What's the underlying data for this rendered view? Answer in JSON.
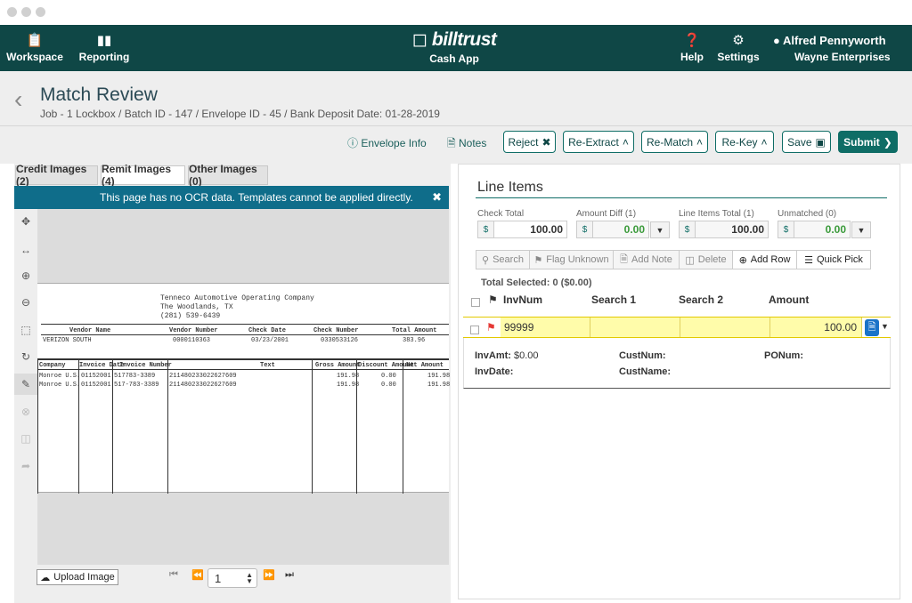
{
  "nav": {
    "workspace": "Workspace",
    "reporting": "Reporting",
    "brand": "billtrust",
    "brand_sub": "Cash App",
    "help": "Help",
    "settings": "Settings",
    "user_name": "Alfred Pennyworth",
    "user_org": "Wayne Enterprises"
  },
  "header": {
    "title": "Match Review",
    "breadcrumb": "Job - 1 Lockbox / Batch ID - 147 / Envelope ID - 45 / Bank Deposit Date: 01-28-2019"
  },
  "toolbar": {
    "envelope_info": "Envelope Info",
    "notes": "Notes",
    "reject": "Reject",
    "re_extract": "Re-Extract",
    "re_match": "Re-Match",
    "re_key": "Re-Key",
    "save": "Save",
    "submit": "Submit"
  },
  "images": {
    "tabs": [
      "Credit Images (2)",
      "Remit Images (4)",
      "Other Images (0)"
    ],
    "active_tab": 1,
    "banner": "This page has no OCR data. Templates cannot be applied directly.",
    "upload": "Upload Image",
    "page": "1"
  },
  "document": {
    "company": "Tenneco Automotive Operating Company",
    "city": "The Woodlands, TX",
    "phone": "(281) 539-6439",
    "h_vendor_name": "Vendor Name",
    "h_vendor_number": "Vendor Number",
    "h_check_date": "Check Date",
    "h_check_number": "Check Number",
    "h_total_amount": "Total Amount",
    "vendor_name": "VERIZON SOUTH",
    "vendor_number": "0000110363",
    "check_date": "03/23/2001",
    "check_number": "0330533126",
    "total_amount": "383.96",
    "cols": [
      "Company",
      "Invoice Date",
      "Invoice Number",
      "Text",
      "Gross Amount",
      "Discount Amount",
      "Net Amount"
    ],
    "rows": [
      [
        "Monroe U.S.",
        "01152001",
        "517783-3389",
        "211480233022627609",
        "191.98",
        "0.00",
        "191.98"
      ],
      [
        "Monroe U.S.",
        "01152001",
        "517-783-3389",
        "211480233022627609",
        "191.98",
        "0.00",
        "191.98"
      ]
    ]
  },
  "line_items": {
    "title": "Line Items",
    "check_total_label": "Check Total",
    "check_total": "100.00",
    "amount_diff_label": "Amount Diff (1)",
    "amount_diff": "0.00",
    "line_items_total_label": "Line Items Total (1)",
    "line_items_total": "100.00",
    "unmatched_label": "Unmatched (0)",
    "unmatched": "0.00",
    "currency": "$",
    "actions": [
      "Search",
      "Flag Unknown",
      "Add Note",
      "Delete",
      "Add Row",
      "Quick Pick"
    ],
    "total_selected": "Total Selected: 0 ($0.00)",
    "columns": [
      "InvNum",
      "Search 1",
      "Search 2",
      "Amount"
    ],
    "row": {
      "invnum": "99999",
      "search1": "",
      "search2": "",
      "amount": "100.00"
    },
    "details": {
      "invamt_label": "InvAmt:",
      "invamt": "$0.00",
      "custnum_label": "CustNum:",
      "ponum_label": "PONum:",
      "invdate_label": "InvDate:",
      "custname_label": "CustName:"
    }
  },
  "colors": {
    "nav": "#0f4746",
    "accent": "#0f6d66",
    "banner": "#0f6d8a",
    "flag": "#e53935",
    "highlight": "#fffcaa"
  }
}
